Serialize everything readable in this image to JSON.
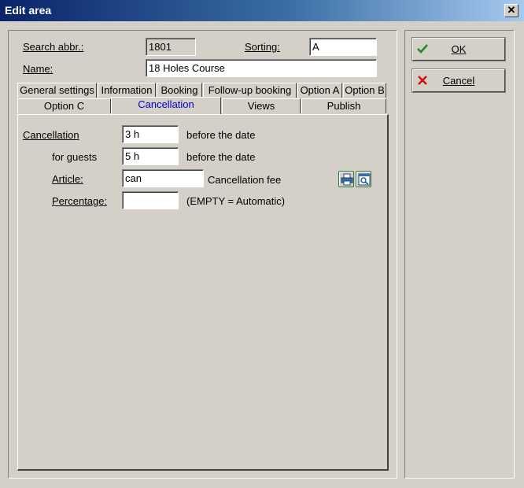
{
  "window": {
    "title": "Edit area",
    "close_glyph": "✕"
  },
  "header": {
    "search_abbr_label": "Search abbr.:",
    "search_abbr_value": "1801",
    "sorting_label": "Sorting:",
    "sorting_value": "A",
    "name_label": "Name:",
    "name_value": "18 Holes Course"
  },
  "tabs_row1": [
    "General settings",
    "Information",
    "Booking",
    "Follow-up booking",
    "Option A",
    "Option B"
  ],
  "tabs_row2": [
    "Option C",
    "Cancellation",
    "Views",
    "Publish"
  ],
  "active_tab": "Cancellation",
  "cancellation": {
    "cancellation_label": "Cancellation",
    "cancellation_value": "3 h",
    "cancellation_suffix": "before the date",
    "guests_label": "for guests",
    "guests_value": "5 h",
    "guests_suffix": "before the date",
    "article_label": "Article:",
    "article_value": "can",
    "article_description": "Cancellation fee",
    "percentage_label": "Percentage:",
    "percentage_value": "",
    "percentage_hint": "(EMPTY = Automatic)",
    "lookup_icons": [
      "print-icon",
      "search-window-icon"
    ]
  },
  "buttons": {
    "ok_label": "OK",
    "cancel_label": "Cancel",
    "ok_icon": "checkmark-icon",
    "cancel_icon": "red-x-icon"
  },
  "colors": {
    "title_gradient_start": "#0a246a",
    "active_tab_text": "#0000d0",
    "ok_check": "#1a8a2a",
    "cancel_x": "#d01010"
  }
}
